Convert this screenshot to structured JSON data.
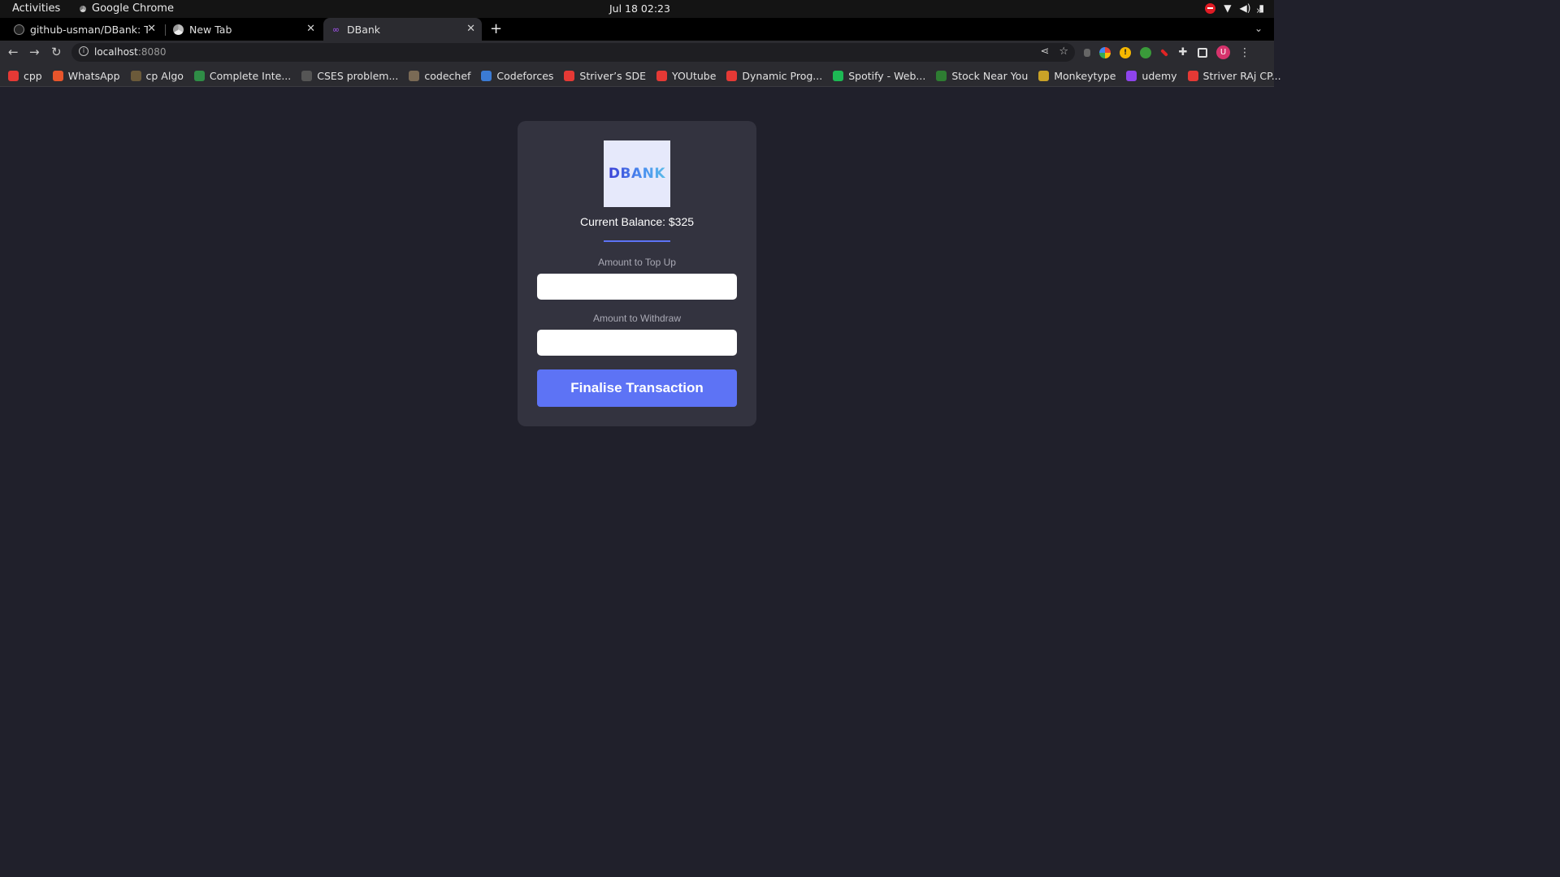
{
  "system_bar": {
    "activities": "Activities",
    "app_name": "Google Chrome",
    "clock": "Jul 18  02:23"
  },
  "tabs": [
    {
      "title": "github-usman/DBank: Th",
      "icon": "github-icon",
      "active": false
    },
    {
      "title": "New Tab",
      "icon": "chrome-icon",
      "active": false
    },
    {
      "title": "DBank",
      "icon": "dfinity-icon",
      "active": true
    }
  ],
  "address_bar": {
    "host": "localhost",
    "port": ":8080"
  },
  "bookmarks": [
    {
      "label": "cpp",
      "icon": "youtube-icon",
      "color": "#e53935"
    },
    {
      "label": "WhatsApp",
      "icon": "alert-icon",
      "color": "#e8552b"
    },
    {
      "label": "cp Algo",
      "icon": "lion-icon",
      "color": "#6b5a3a"
    },
    {
      "label": "Complete Inte...",
      "icon": "gfg-icon",
      "color": "#2f8d46"
    },
    {
      "label": "CSES problem...",
      "icon": "cses-icon",
      "color": "#555555"
    },
    {
      "label": "codechef",
      "icon": "codechef-icon",
      "color": "#7a6a55"
    },
    {
      "label": "Codeforces",
      "icon": "codeforces-icon",
      "color": "#3b7bd4"
    },
    {
      "label": "Striver’s SDE",
      "icon": "tuf-icon",
      "color": "#e53935"
    },
    {
      "label": "YOUtube",
      "icon": "youtube-icon",
      "color": "#e53935"
    },
    {
      "label": "Dynamic Prog...",
      "icon": "youtube-icon",
      "color": "#e53935"
    },
    {
      "label": "Spotify - Web...",
      "icon": "spotify-icon",
      "color": "#1db954"
    },
    {
      "label": "Stock Near You",
      "icon": "cart-icon",
      "color": "#2e7d32"
    },
    {
      "label": "Monkeytype",
      "icon": "monkeytype-icon",
      "color": "#c9a227"
    },
    {
      "label": "udemy",
      "icon": "udemy-icon",
      "color": "#8e44ec"
    },
    {
      "label": "Striver RAj CP...",
      "icon": "tuf-icon",
      "color": "#e53935"
    }
  ],
  "app": {
    "logo_text": "DBANK",
    "balance_text": "Current Balance: $325",
    "topup_label": "Amount to Top Up",
    "topup_value": "",
    "withdraw_label": "Amount to Withdraw",
    "withdraw_value": "",
    "submit_label": "Finalise Transaction",
    "accent_color": "#5d73f5"
  }
}
